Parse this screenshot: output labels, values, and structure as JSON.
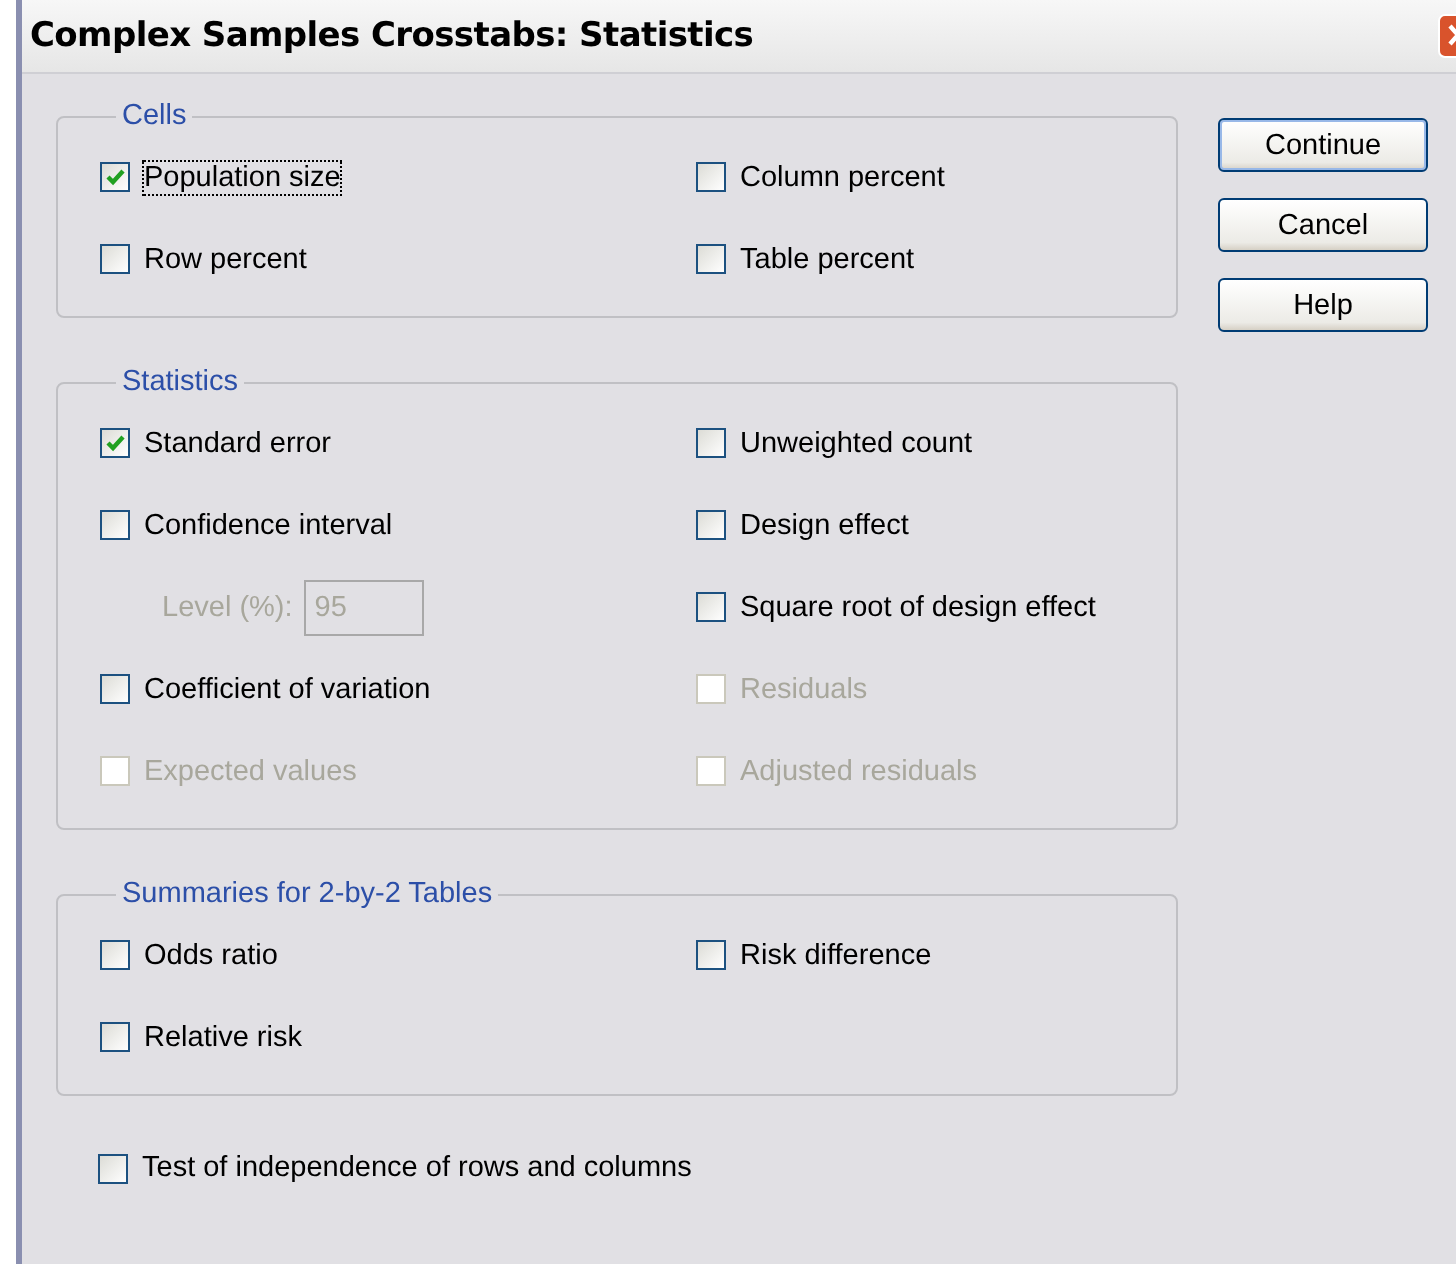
{
  "window": {
    "title": "Complex Samples Crosstabs: Statistics"
  },
  "groups": [
    {
      "title": "Cells",
      "items": [
        {
          "kind": "checkbox",
          "label": "Population size",
          "checked": true,
          "disabled": false,
          "focused": true
        },
        {
          "kind": "checkbox",
          "label": "Column percent",
          "checked": false,
          "disabled": false
        },
        {
          "kind": "checkbox",
          "label": "Row percent",
          "checked": false,
          "disabled": false
        },
        {
          "kind": "checkbox",
          "label": "Table percent",
          "checked": false,
          "disabled": false
        }
      ]
    },
    {
      "title": "Statistics",
      "items": [
        {
          "kind": "checkbox",
          "label": "Standard error",
          "checked": true,
          "disabled": false
        },
        {
          "kind": "checkbox",
          "label": "Unweighted count",
          "checked": false,
          "disabled": false
        },
        {
          "kind": "checkbox",
          "label": "Confidence interval",
          "checked": false,
          "disabled": false
        },
        {
          "kind": "checkbox",
          "label": "Design effect",
          "checked": false,
          "disabled": false
        },
        {
          "kind": "field",
          "label": "Level (%):",
          "value": "95",
          "disabled": true
        },
        {
          "kind": "checkbox",
          "label": "Square root of design effect",
          "checked": false,
          "disabled": false
        },
        {
          "kind": "checkbox",
          "label": "Coefficient of variation",
          "checked": false,
          "disabled": false
        },
        {
          "kind": "checkbox",
          "label": "Residuals",
          "checked": false,
          "disabled": true
        },
        {
          "kind": "checkbox",
          "label": "Expected values",
          "checked": false,
          "disabled": true
        },
        {
          "kind": "checkbox",
          "label": "Adjusted residuals",
          "checked": false,
          "disabled": true
        }
      ]
    },
    {
      "title": "Summaries for 2-by-2 Tables",
      "items": [
        {
          "kind": "checkbox",
          "label": "Odds ratio",
          "checked": false,
          "disabled": false
        },
        {
          "kind": "checkbox",
          "label": "Risk difference",
          "checked": false,
          "disabled": false
        },
        {
          "kind": "checkbox",
          "label": "Relative risk",
          "checked": false,
          "disabled": false
        }
      ]
    }
  ],
  "test": {
    "label": "Test of independence of rows and columns",
    "checked": false,
    "disabled": false
  },
  "buttons": [
    {
      "label": "Continue",
      "default": true
    },
    {
      "label": "Cancel",
      "default": false
    },
    {
      "label": "Help",
      "default": false
    }
  ]
}
